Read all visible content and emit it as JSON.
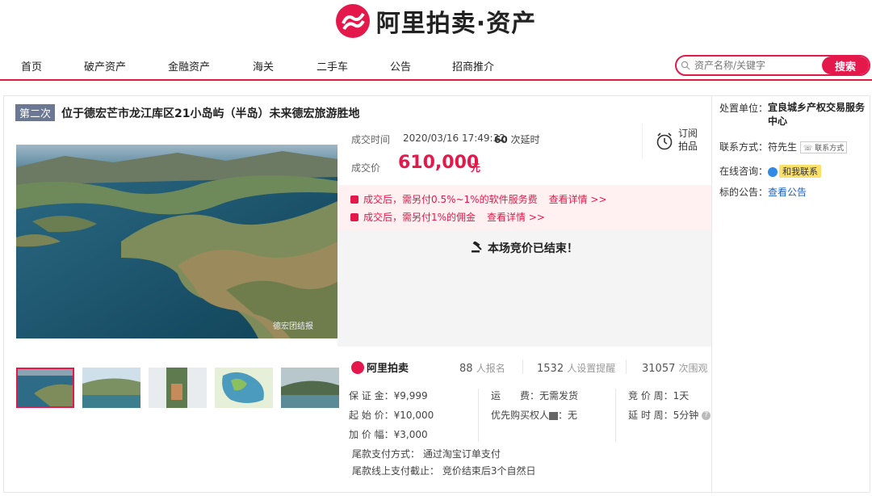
{
  "brand": {
    "logo_text": "阿里拍卖·资产",
    "accent": "#e4184b"
  },
  "nav": {
    "items": [
      "首页",
      "破产资产",
      "金融资产",
      "海关",
      "二手车",
      "公告",
      "招商推介"
    ]
  },
  "search": {
    "placeholder": "资产名称/关键字",
    "button": "搜索"
  },
  "item": {
    "round": "第二次",
    "title": "位于德宏芒市龙江库区21小岛屿（半岛）未来德宏旅游胜地",
    "watermark": "德宏团结报",
    "deal_time_label": "成交时间",
    "deal_time": "2020/03/16 17:49:32",
    "delay_count": "60",
    "delay_suffix": "次延时",
    "subscribe": "订阅拍品",
    "price_label": "成交价",
    "price": "610,000",
    "price_unit": "元",
    "fee1": "成交后，需另付0.5%~1%的软件服务费",
    "fee2": "成交后，需另付1%的佣金",
    "fee_more": "查看详情 >>",
    "ended": "本场竞价已结束！"
  },
  "stats": {
    "brand": "阿里拍卖",
    "signups": "88",
    "signups_label": "人报名",
    "reminders": "1532",
    "reminders_label": "人设置提醒",
    "views": "31057",
    "views_label": "次围观"
  },
  "params": {
    "deposit": "保 证 金：¥9,999",
    "start": "起 始 价：¥10,000",
    "increment": "加 价 幅：¥3,000",
    "shipping": "运　　费：无需发货",
    "priority": "优先购买权人",
    "priority_val": "：无",
    "cycle": "竞 价 周：1天",
    "delay": "延 时 周：5分钟",
    "pay_method": "尾款支付方式：  通过淘宝订单支付",
    "pay_deadline": "尾款线上支付截止：  竞价结束后3个自然日"
  },
  "side": {
    "unit_label": "处置单位：",
    "unit": "宜良城乡产权交易服务中心",
    "contact_label": "联系方式：",
    "contact": "符先生",
    "contact_tag": "联系方式",
    "online_label": "在线咨询：",
    "online": "和我联系",
    "notice_label": "标的公告：",
    "notice": "查看公告"
  }
}
